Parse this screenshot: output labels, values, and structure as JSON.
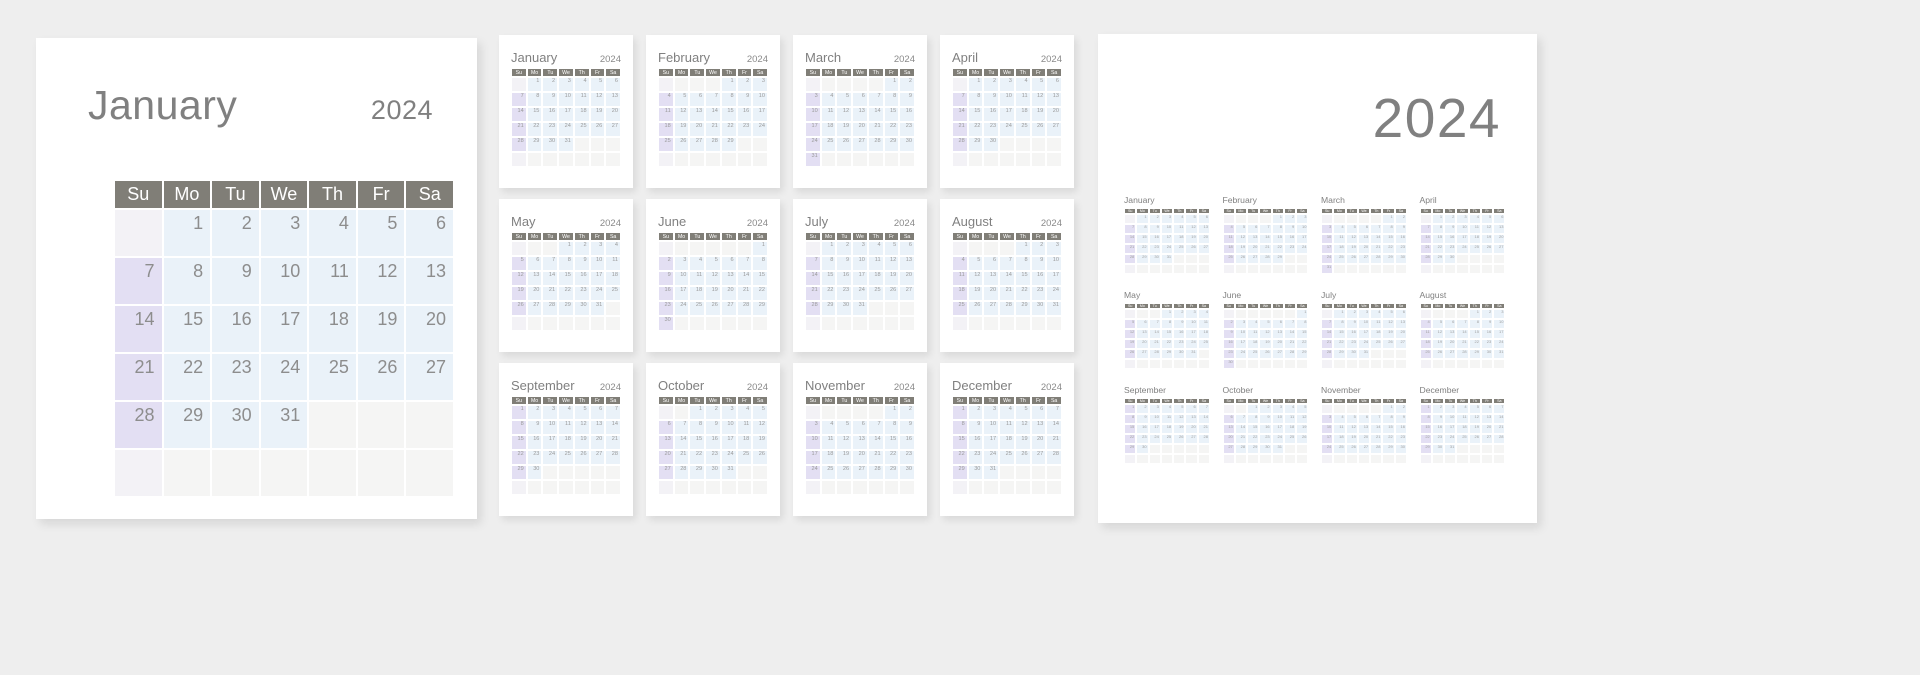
{
  "year": "2024",
  "palette": {
    "page_background": "#eeeeee",
    "card_background": "#ffffff",
    "weekday_header": "#807e77",
    "weekday_header_text": "#ffffff",
    "sunday_cell": "#e3dff3",
    "weekday_cell": "#eaf2f9",
    "empty_cell": "#f5f5f4",
    "month_title_text": "#808080",
    "day_number_text": "#8d8d8d"
  },
  "weekday_labels": [
    "Su",
    "Mo",
    "Tu",
    "We",
    "Th",
    "Fr",
    "Sa"
  ],
  "featured_month": {
    "name": "January",
    "year": "2024",
    "lead_blanks": 1,
    "days": 31,
    "trailing_blanks": 10
  },
  "months": [
    {
      "name": "January",
      "year": "2024",
      "lead_blanks": 1,
      "days": 31
    },
    {
      "name": "February",
      "year": "2024",
      "lead_blanks": 4,
      "days": 29
    },
    {
      "name": "March",
      "year": "2024",
      "lead_blanks": 5,
      "days": 31
    },
    {
      "name": "April",
      "year": "2024",
      "lead_blanks": 1,
      "days": 30
    },
    {
      "name": "May",
      "year": "2024",
      "lead_blanks": 3,
      "days": 31
    },
    {
      "name": "June",
      "year": "2024",
      "lead_blanks": 6,
      "days": 30
    },
    {
      "name": "July",
      "year": "2024",
      "lead_blanks": 1,
      "days": 31
    },
    {
      "name": "August",
      "year": "2024",
      "lead_blanks": 4,
      "days": 31
    },
    {
      "name": "September",
      "year": "2024",
      "lead_blanks": 0,
      "days": 30
    },
    {
      "name": "October",
      "year": "2024",
      "lead_blanks": 2,
      "days": 31
    },
    {
      "name": "November",
      "year": "2024",
      "lead_blanks": 5,
      "days": 30
    },
    {
      "name": "December",
      "year": "2024",
      "lead_blanks": 0,
      "days": 31
    }
  ],
  "year_overview": {
    "title": "2024",
    "months": [
      {
        "name": "January",
        "lead_blanks": 1,
        "days": 31
      },
      {
        "name": "February",
        "lead_blanks": 4,
        "days": 29
      },
      {
        "name": "March",
        "lead_blanks": 5,
        "days": 31
      },
      {
        "name": "April",
        "lead_blanks": 1,
        "days": 30
      },
      {
        "name": "May",
        "lead_blanks": 3,
        "days": 31
      },
      {
        "name": "June",
        "lead_blanks": 6,
        "days": 30
      },
      {
        "name": "July",
        "lead_blanks": 1,
        "days": 31
      },
      {
        "name": "August",
        "lead_blanks": 4,
        "days": 31
      },
      {
        "name": "September",
        "lead_blanks": 0,
        "days": 30
      },
      {
        "name": "October",
        "lead_blanks": 2,
        "days": 31
      },
      {
        "name": "November",
        "lead_blanks": 5,
        "days": 30
      },
      {
        "name": "December",
        "lead_blanks": 0,
        "days": 31
      }
    ]
  }
}
